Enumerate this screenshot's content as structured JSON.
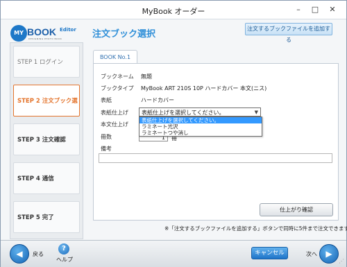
{
  "window": {
    "title": "MyBook オーダー",
    "controls": [
      "minimize",
      "maximize",
      "close"
    ]
  },
  "logo": {
    "circle_text": "MY",
    "name": "BOOK",
    "suffix": "Editor",
    "tagline": "DESIGNING PHOTO BOOK"
  },
  "header": {
    "title": "注文ブック選択",
    "add_button_label": "注文するブックファイルを追加する"
  },
  "steps": [
    {
      "label": "STEP 1  ログイン",
      "state": "inactive"
    },
    {
      "label": "STEP 2  注文ブック選択",
      "state": "active"
    },
    {
      "label": "STEP 3  注文確認",
      "state": "done"
    },
    {
      "label": "STEP 4  通信",
      "state": "done"
    },
    {
      "label": "STEP 5  完了",
      "state": "done"
    }
  ],
  "book_tab": {
    "label": "BOOK No.1"
  },
  "form": {
    "book_name_label": "ブックネーム",
    "book_name_value": "無題",
    "book_type_label": "ブックタイプ",
    "book_type_value": "MyBook ART 210S 10P ハードカバー 本文(ニス)",
    "cover_label": "表紙",
    "cover_value": "ハードカバー",
    "cover_finish_label": "表紙仕上げ",
    "cover_finish_selected": "表紙仕上げを選択してください。",
    "cover_finish_options": [
      "表紙仕上げを選択してください。",
      "ラミネート光沢",
      "ラミネートつや消し"
    ],
    "body_finish_label": "本文仕上げ",
    "quantity_label": "冊数",
    "quantity_value": "1",
    "quantity_unit": "冊",
    "notes_label": "備考",
    "notes_value": ""
  },
  "confirm_button_label": "仕上がり確認",
  "footer_note": "※「注文するブックファイルを追加する」ボタンで同時に5件まで注文できます。",
  "bottom": {
    "back_label": "戻る",
    "help_label": "ヘルプ",
    "cancel_label": "キャンセル",
    "next_label": "次へ"
  },
  "colors": {
    "accent": "#2f8fd8",
    "active_step": "#e4742c",
    "selection": "#3399ff"
  }
}
